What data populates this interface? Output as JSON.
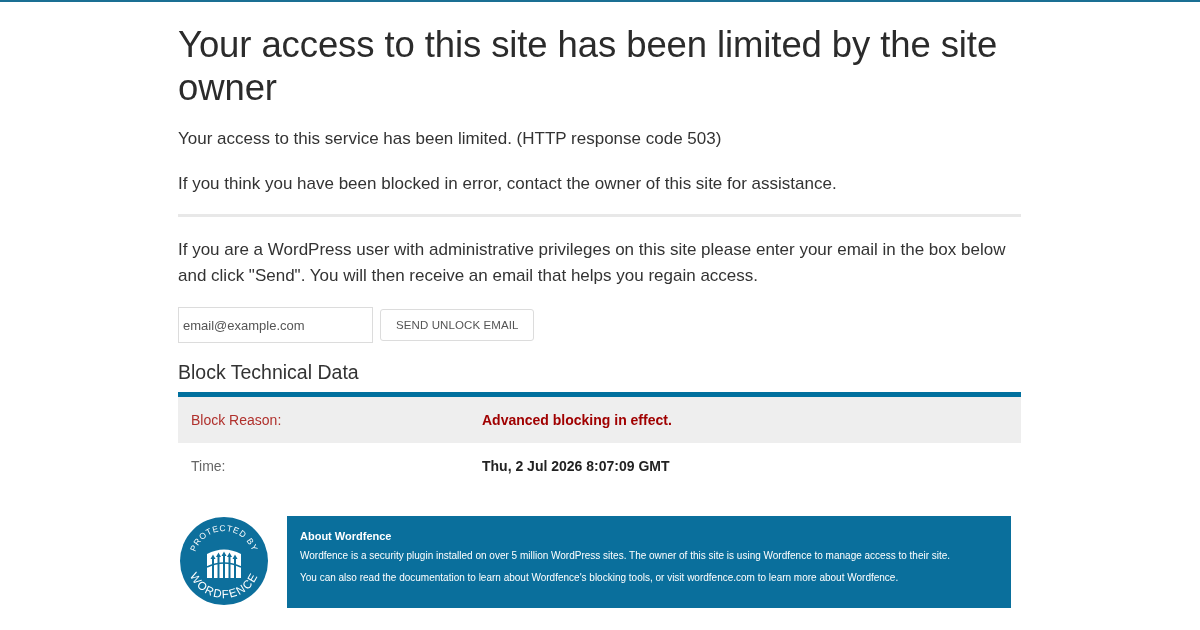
{
  "heading": "Your access to this site has been limited by the site owner",
  "messages": [
    "Your access to this service has been limited. (HTTP response code 503)",
    "If you think you have been blocked in error, contact the owner of this site for assistance."
  ],
  "unlock": {
    "instructions": "If you are a WordPress user with administrative privileges on this site please enter your email in the box below and click \"Send\". You will then receive an email that helps you regain access.",
    "email_field": {
      "placeholder": "email@example.com"
    },
    "button": "SEND UNLOCK EMAIL"
  },
  "technical_data": {
    "title": "Block Technical Data",
    "rows": [
      {
        "kind": "reason",
        "label": "Block Reason:",
        "value": "Advanced blocking in effect."
      },
      {
        "kind": "time",
        "label": "Time:",
        "value": "Thu, 2 Jul 2026 8:07:09 GMT"
      }
    ]
  },
  "footer": {
    "badge": {
      "top_text": "PROTECTED BY",
      "bottom_text": "WORDFENCE"
    },
    "about": {
      "title": "About Wordfence",
      "paragraphs": [
        "Wordfence is a security plugin installed on over 5 million WordPress sites. The owner of this site is using Wordfence to manage access to their site.",
        "You can also read the documentation to learn about Wordfence's blocking tools, or visit wordfence.com to learn more about Wordfence."
      ]
    }
  }
}
